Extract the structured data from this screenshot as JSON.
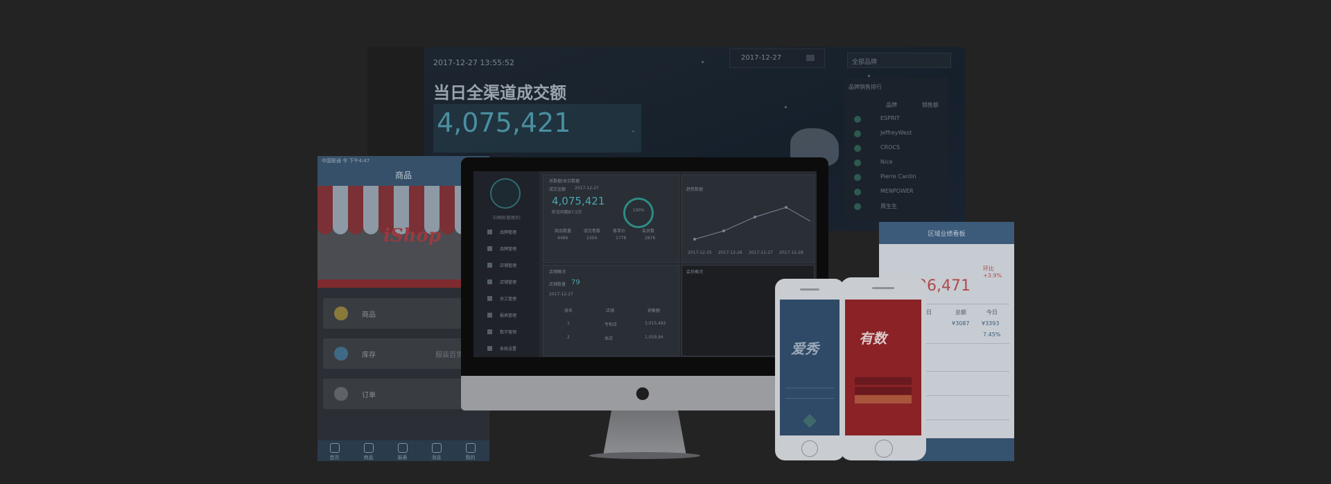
{
  "background": {
    "timestamp": "2017-12-27 13:55:52",
    "title": "当日全渠道成交额",
    "amount": "4,075,421",
    "date": "2017-12-27",
    "search_placeholder": "全部品牌",
    "rank_title": "品牌销售排行",
    "rank_header": [
      "品牌",
      "销售额"
    ],
    "rank_items": [
      "ESPRIT",
      "JeffreyWest",
      "CROCS",
      "Nice",
      "Pierre Cardin",
      "MENPOWER",
      "周生生"
    ]
  },
  "left_phone": {
    "status": "中国联通 令   下午4:47",
    "header": "商品",
    "logo": "iShop",
    "rows": [
      {
        "label": "商品",
        "value": "商品"
      },
      {
        "label": "库存",
        "value": "服装百货发行"
      },
      {
        "label": "订单",
        "value": "商品"
      }
    ],
    "tabs": [
      "首页",
      "商品",
      "报表",
      "消息",
      "我的"
    ]
  },
  "imac": {
    "user": "王国刚(管理员)",
    "menu": [
      "品牌管理",
      "品牌管理",
      "店铺管理",
      "店铺管理",
      "员工管理",
      "报表管理",
      "数字营销",
      "系统设置"
    ],
    "sales_panel_title": "总数据/本日数据",
    "sales_label": "成交金额",
    "date_range": "2017-12-27",
    "amount": "4,075,421",
    "amount_sub": "昨日同期87,5万",
    "ring": "100%",
    "stats_headers": [
      "商品数量",
      "成交笔数",
      "客单价",
      "会员数"
    ],
    "stats_values": [
      "4466",
      "2304",
      "1778",
      "2876"
    ],
    "chart_label": "趋势数据",
    "chart_dates": [
      "2017-12-25",
      "2017-12-26",
      "2017-12-27",
      "2017-12-28"
    ],
    "shop_panel_title": "店铺概况",
    "shop_count_label": "店铺数量",
    "shop_count": "79",
    "table_headers": [
      "排名",
      "店铺",
      "销售额"
    ],
    "table_rows": [
      [
        "1",
        "专柜店",
        "3,015,482"
      ],
      [
        "2",
        "本店",
        "1,059,94"
      ]
    ],
    "right_panel_title": "会员概况"
  },
  "tablet": {
    "header": "区域业绩看板",
    "big_number": "36,471",
    "red_pct": "环比 +3.9%",
    "cells": [
      "昨日",
      "总额",
      "今日",
      "¥3087",
      "¥3393",
      "7.45%"
    ]
  },
  "phone_white": {
    "logo": "爱秀"
  },
  "phone_red": {
    "logo": "有数"
  },
  "colors": {
    "background": "#232323",
    "accent_teal": "#4aa6b0",
    "brand_red": "#8a2226"
  },
  "icons": [
    "apple-logo-icon",
    "user-avatar-icon",
    "calendar-icon",
    "home-icon"
  ]
}
